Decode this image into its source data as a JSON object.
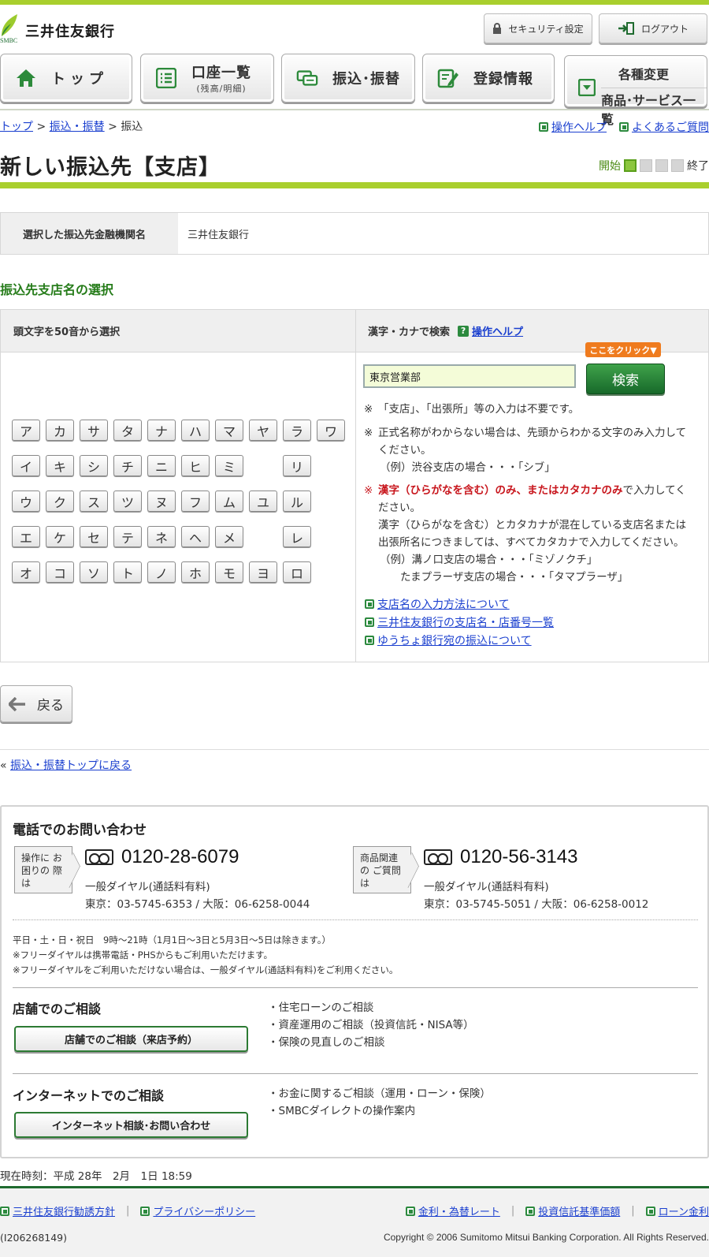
{
  "header": {
    "bank_name": "三井住友銀行",
    "logo_small": "SMBC",
    "security_label": "セキュリティ設定",
    "logout_label": "ログアウト"
  },
  "nav": {
    "top": "トップ",
    "accounts": "口座一覧",
    "accounts_sub": "(残高/明細)",
    "transfer": "振込･振替",
    "registration": "登録情報",
    "changes_l1": "各種変更",
    "changes_l2": "商品･サービス一覧"
  },
  "breadcrumb": {
    "items": [
      "トップ",
      "振込・振替",
      "振込"
    ],
    "sep": ">"
  },
  "help": {
    "operation_help": "操作ヘルプ",
    "faq": "よくあるご質問"
  },
  "page_title": "新しい振込先【支店】",
  "steps": {
    "start": "開始",
    "end": "終了",
    "current": 1,
    "total": 4
  },
  "bank_row": {
    "label": "選択した振込先金融機関名",
    "value": "三井住友銀行"
  },
  "section_title": "振込先支店名の選択",
  "select": {
    "left_header": "頭文字を50音から選択",
    "right_header": "漢字・カナで検索",
    "help_link": "操作ヘルプ",
    "kana_rows": [
      [
        "ア",
        "カ",
        "サ",
        "タ",
        "ナ",
        "ハ",
        "マ",
        "ヤ",
        "ラ",
        "ワ"
      ],
      [
        "イ",
        "キ",
        "シ",
        "チ",
        "ニ",
        "ヒ",
        "ミ",
        "",
        "リ",
        ""
      ],
      [
        "ウ",
        "ク",
        "ス",
        "ツ",
        "ヌ",
        "フ",
        "ム",
        "ユ",
        "ル",
        ""
      ],
      [
        "エ",
        "ケ",
        "セ",
        "テ",
        "ネ",
        "ヘ",
        "メ",
        "",
        "レ",
        ""
      ],
      [
        "オ",
        "コ",
        "ソ",
        "ト",
        "ノ",
        "ホ",
        "モ",
        "ヨ",
        "ロ",
        ""
      ]
    ]
  },
  "search": {
    "click_here": "ここをクリック▼",
    "value": "東京営業部",
    "button": "検索",
    "note1": "「支店」、「出張所」等の入力は不要です。",
    "note2a": "正式名称がわからない場合は、先頭からわかる文字のみ入力して",
    "note2b": "ください。",
    "note2c": "（例）渋谷支店の場合・・・「シブ」",
    "note3_red": "漢字（ひらがなを含む）のみ、またはカタカナのみ",
    "note3a": "で入力してく",
    "note3b": "ださい。",
    "note3c": "漢字（ひらがなを含む）とカタカナが混在している支店名または",
    "note3d": "出張所名につきましては、すべてカタカナで入力してください。",
    "note3e": "（例）溝ノ口支店の場合・・・「ミゾノクチ」",
    "note3f": "たまプラーザ支店の場合・・・「タマプラーザ」",
    "mark": "※",
    "links": [
      "支店名の入力方法について",
      "三井住友銀行の支店名・店番号一覧",
      "ゆうちょ銀行宛の振込について"
    ]
  },
  "back_button": "戻る",
  "return_prefix": "«",
  "return_link": "振込・振替トップに戻る",
  "contact": {
    "title": "電話でのお問い合わせ",
    "tag1": "操作に お困りの 際は",
    "tag2": "商品関連の ご質問は",
    "phone1": "0120-28-6079",
    "phone2": "0120-56-3143",
    "general": "一般ダイヤル(通話料有料)",
    "local1": "東京：03-5745-6353 / 大阪：06-6258-0044",
    "local2": "東京：03-5745-5051 / 大阪：06-6258-0012",
    "hours1": "平日・土・日・祝日　9時〜21時（1月1日〜3日と5月3日〜5日は除きます。）",
    "hours2": "※フリーダイヤルは携帯電話・PHSからもご利用いただけます。",
    "hours3": "※フリーダイヤルをご利用いただけない場合は、一般ダイヤル(通話料有料)をご利用ください。",
    "store_title": "店舗でのご相談",
    "store_button": "店舗でのご相談（来店予約）",
    "store_items": [
      "・住宅ローンのご相談",
      "・資産運用のご相談（投資信託・NISA等）",
      "・保険の見直しのご相談"
    ],
    "net_title": "インターネットでのご相談",
    "net_button": "インターネット相談･お問い合わせ",
    "net_items": [
      "・お金に関するご相談（運用・ローン・保険）",
      "・SMBCダイレクトの操作案内"
    ]
  },
  "current_time": "現在時刻：平成 28年　2月　1日 18:59",
  "footer": {
    "left_links": [
      "三井住友銀行勧誘方針",
      "プライバシーポリシー"
    ],
    "right_links": [
      "金利・為替レート",
      "投資信託基準価額",
      "ローン金利"
    ],
    "divider": "|",
    "id": "(I206268149)",
    "copyright": "Copyright © 2006 Sumitomo Mitsui Banking Corporation. All Rights Reserved."
  },
  "colors": {
    "accent_green": "#a9cf2d",
    "dark_green": "#1f6b2f",
    "link": "#1a3fcf",
    "orange": "#ef7b1e",
    "red": "#c8161d"
  }
}
